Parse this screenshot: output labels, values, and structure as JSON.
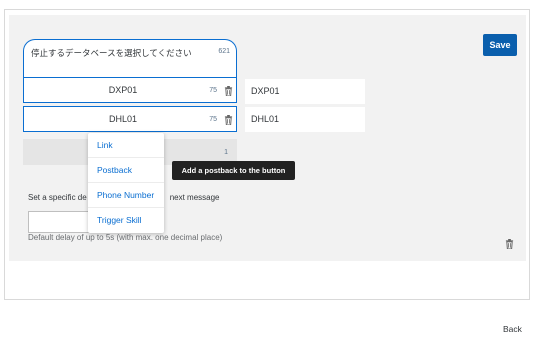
{
  "toolbar": {
    "save_label": "Save"
  },
  "question": {
    "text": "停止するデータベースを選択してください",
    "char_count": "621"
  },
  "buttons": [
    {
      "label": "DXP01",
      "char_count": "75",
      "value": "DXP01"
    },
    {
      "label": "DHL01",
      "char_count": "75",
      "value": "DHL01"
    }
  ],
  "new_button": {
    "char_count": "1"
  },
  "context_menu": {
    "items": [
      "Link",
      "Postback",
      "Phone Number",
      "Trigger Skill"
    ]
  },
  "tooltip": {
    "text": "Add a postback to the button"
  },
  "delay": {
    "label_start": "Set a specific de",
    "label_end": "next message",
    "hint": "Default delay of up to 5s (with max. one decimal place)"
  },
  "footer": {
    "back_label": "Back"
  },
  "icons": [
    "trash-icon"
  ],
  "colors": {
    "accent": "#0a6ed1",
    "save_button": "#0a5fad"
  }
}
